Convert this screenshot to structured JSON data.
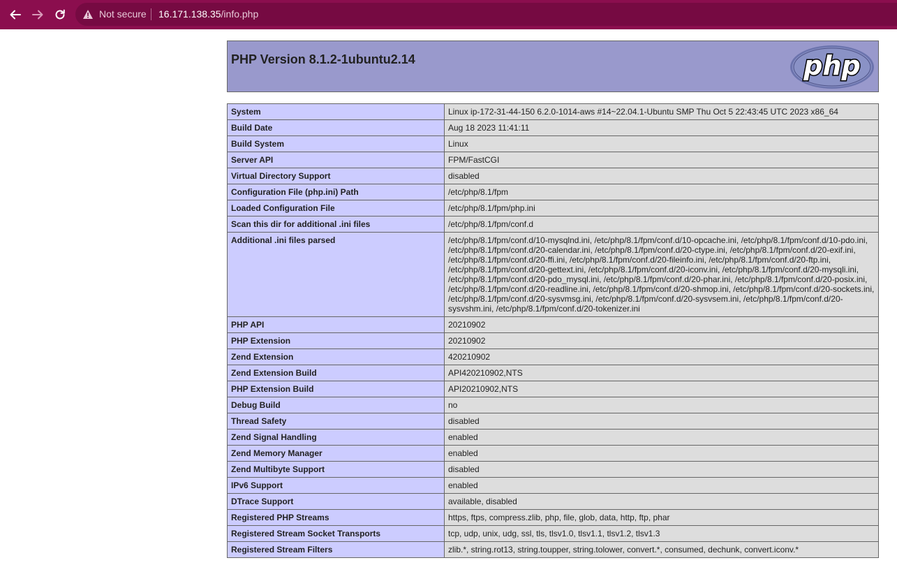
{
  "browser": {
    "security_label": "Not secure",
    "url_host": "16.171.138.35",
    "url_path": "/info.php"
  },
  "icons": {
    "back": "arrow-left-icon",
    "forward": "arrow-right-icon",
    "reload": "reload-icon",
    "security": "warning-triangle-icon",
    "logo": "php-logo"
  },
  "colors": {
    "browser_bar": "#8b0e4e",
    "header_bg": "#9999cc",
    "label_bg": "#ccccff",
    "value_bg": "#dddddd"
  },
  "header": {
    "title": "PHP Version 8.1.2-1ubuntu2.14",
    "logo_text": "php"
  },
  "rows": [
    {
      "label": "System",
      "value": "Linux ip-172-31-44-150 6.2.0-1014-aws #14~22.04.1-Ubuntu SMP Thu Oct 5 22:43:45 UTC 2023 x86_64"
    },
    {
      "label": "Build Date",
      "value": "Aug 18 2023 11:41:11"
    },
    {
      "label": "Build System",
      "value": "Linux"
    },
    {
      "label": "Server API",
      "value": "FPM/FastCGI"
    },
    {
      "label": "Virtual Directory Support",
      "value": "disabled"
    },
    {
      "label": "Configuration File (php.ini) Path",
      "value": "/etc/php/8.1/fpm"
    },
    {
      "label": "Loaded Configuration File",
      "value": "/etc/php/8.1/fpm/php.ini"
    },
    {
      "label": "Scan this dir for additional .ini files",
      "value": "/etc/php/8.1/fpm/conf.d"
    },
    {
      "label": "Additional .ini files parsed",
      "value": "/etc/php/8.1/fpm/conf.d/10-mysqlnd.ini, /etc/php/8.1/fpm/conf.d/10-opcache.ini, /etc/php/8.1/fpm/conf.d/10-pdo.ini, /etc/php/8.1/fpm/conf.d/20-calendar.ini, /etc/php/8.1/fpm/conf.d/20-ctype.ini, /etc/php/8.1/fpm/conf.d/20-exif.ini, /etc/php/8.1/fpm/conf.d/20-ffi.ini, /etc/php/8.1/fpm/conf.d/20-fileinfo.ini, /etc/php/8.1/fpm/conf.d/20-ftp.ini, /etc/php/8.1/fpm/conf.d/20-gettext.ini, /etc/php/8.1/fpm/conf.d/20-iconv.ini, /etc/php/8.1/fpm/conf.d/20-mysqli.ini, /etc/php/8.1/fpm/conf.d/20-pdo_mysql.ini, /etc/php/8.1/fpm/conf.d/20-phar.ini, /etc/php/8.1/fpm/conf.d/20-posix.ini, /etc/php/8.1/fpm/conf.d/20-readline.ini, /etc/php/8.1/fpm/conf.d/20-shmop.ini, /etc/php/8.1/fpm/conf.d/20-sockets.ini, /etc/php/8.1/fpm/conf.d/20-sysvmsg.ini, /etc/php/8.1/fpm/conf.d/20-sysvsem.ini, /etc/php/8.1/fpm/conf.d/20-sysvshm.ini, /etc/php/8.1/fpm/conf.d/20-tokenizer.ini"
    },
    {
      "label": "PHP API",
      "value": "20210902"
    },
    {
      "label": "PHP Extension",
      "value": "20210902"
    },
    {
      "label": "Zend Extension",
      "value": "420210902"
    },
    {
      "label": "Zend Extension Build",
      "value": "API420210902,NTS"
    },
    {
      "label": "PHP Extension Build",
      "value": "API20210902,NTS"
    },
    {
      "label": "Debug Build",
      "value": "no"
    },
    {
      "label": "Thread Safety",
      "value": "disabled"
    },
    {
      "label": "Zend Signal Handling",
      "value": "enabled"
    },
    {
      "label": "Zend Memory Manager",
      "value": "enabled"
    },
    {
      "label": "Zend Multibyte Support",
      "value": "disabled"
    },
    {
      "label": "IPv6 Support",
      "value": "enabled"
    },
    {
      "label": "DTrace Support",
      "value": "available, disabled"
    },
    {
      "label": "Registered PHP Streams",
      "value": "https, ftps, compress.zlib, php, file, glob, data, http, ftp, phar"
    },
    {
      "label": "Registered Stream Socket Transports",
      "value": "tcp, udp, unix, udg, ssl, tls, tlsv1.0, tlsv1.1, tlsv1.2, tlsv1.3"
    },
    {
      "label": "Registered Stream Filters",
      "value": "zlib.*, string.rot13, string.toupper, string.tolower, convert.*, consumed, dechunk, convert.iconv.*"
    }
  ]
}
